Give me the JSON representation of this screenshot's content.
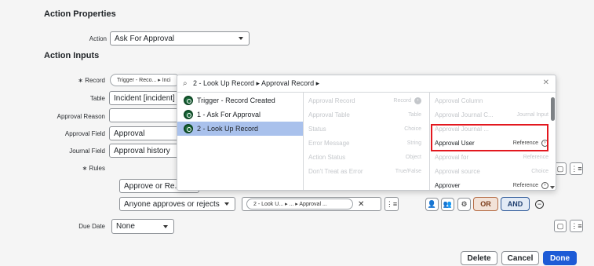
{
  "sections": {
    "action_properties": "Action Properties",
    "action_inputs": "Action Inputs"
  },
  "action": {
    "label": "Action",
    "value": "Ask For Approval"
  },
  "record": {
    "label": "Record",
    "pill_text": "Trigger - Reco... ▸ Inci",
    "required_marker": "∗"
  },
  "table": {
    "label": "Table",
    "value": "Incident [incident]"
  },
  "approval_reason": {
    "label": "Approval Reason",
    "value": ""
  },
  "approval_field": {
    "label": "Approval Field",
    "value": "Approval"
  },
  "journal_field": {
    "label": "Journal Field",
    "value": "Approval history"
  },
  "rules": {
    "label": "Rules",
    "required_marker": "∗",
    "approve_value": "Approve or Re...",
    "condition_value": "Anyone approves or rejects",
    "pill_text": "2 - Look U...  ▸ ...  ▸  Approval ...",
    "or_label": "OR",
    "and_label": "AND"
  },
  "due_date": {
    "label": "Due Date",
    "value": "None"
  },
  "footer": {
    "delete": "Delete",
    "cancel": "Cancel",
    "done": "Done"
  },
  "picker": {
    "search_value": "2 - Look Up Record ▸ Approval Record ▸",
    "col1": [
      "Trigger - Record Created",
      "1 - Ask For Approval",
      "2 - Look Up Record"
    ],
    "col2": [
      {
        "name": "Approval Record",
        "type": "Record"
      },
      {
        "name": "Approval Table",
        "type": "Table"
      },
      {
        "name": "Status",
        "type": "Choice"
      },
      {
        "name": "Error Message",
        "type": "String"
      },
      {
        "name": "Action Status",
        "type": "Object"
      },
      {
        "name": "Don't Treat as Error",
        "type": "True/False"
      }
    ],
    "col3": [
      {
        "name": "Approval Column",
        "type": ""
      },
      {
        "name": "Approval Journal C...",
        "type": "Journal Input"
      },
      {
        "name": "Approval Journal ...",
        "type": ""
      },
      {
        "name": "Approval User",
        "type": "Reference"
      },
      {
        "name": "Approval for",
        "type": "Reference"
      },
      {
        "name": "Approval source",
        "type": "Choice"
      },
      {
        "name": "Approver",
        "type": "Reference"
      }
    ]
  },
  "colors": {
    "highlight": "#e3181f",
    "selected_row": "#a9c1ec",
    "done": "#1d5bd6"
  }
}
